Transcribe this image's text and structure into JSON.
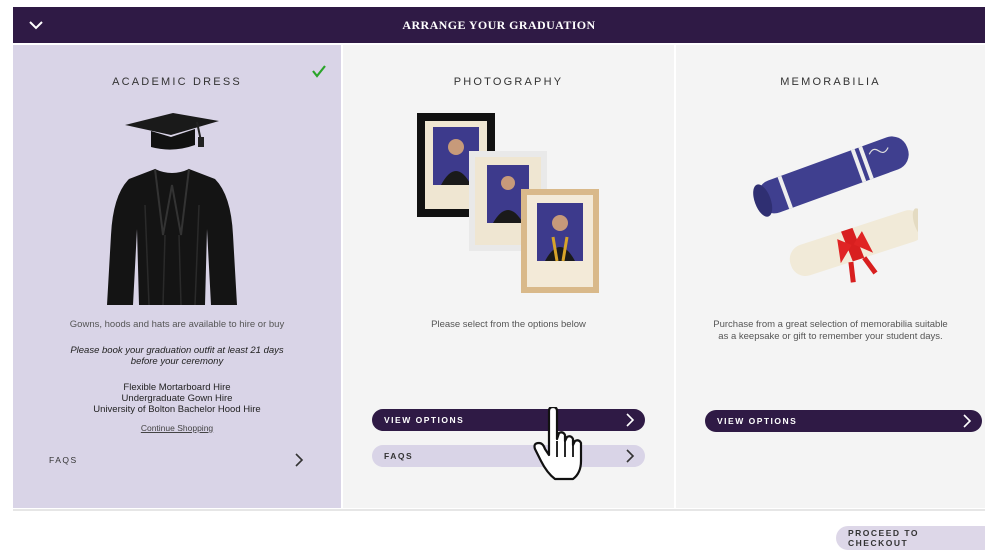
{
  "header": {
    "title": "ARRANGE YOUR GRADUATION",
    "collapse_icon": "chevron-down-icon"
  },
  "academic_dress": {
    "title": "ACADEMIC DRESS",
    "status_icon": "checkmark-icon",
    "status_color": "#2aa52a",
    "description": "Gowns, hoods and hats are available to hire or buy",
    "note_line1": "Please book your graduation outfit at least 21 days",
    "note_line2": "before your ceremony",
    "items": [
      "Flexible Mortarboard Hire",
      "Undergraduate Gown Hire",
      "University of Bolton Bachelor Hood Hire"
    ],
    "continue_link": "Continue Shopping",
    "faqs_label": "FAQS"
  },
  "photography": {
    "title": "PHOTOGRAPHY",
    "description": "Please select from the options below",
    "view_options_label": "VIEW OPTIONS",
    "faqs_label": "FAQS"
  },
  "memorabilia": {
    "title": "MEMORABILIA",
    "description_line1": "Purchase from a great selection of memorabilia suitable",
    "description_line2": "as a keepsake or gift to remember your student days.",
    "view_options_label": "VIEW OPTIONS"
  },
  "footer": {
    "checkout_label": "PROCEED TO CHECKOUT"
  },
  "colors": {
    "brand": "#2f1a45",
    "panel_selected": "#d9d4e7",
    "panel": "#f4f4f4"
  }
}
